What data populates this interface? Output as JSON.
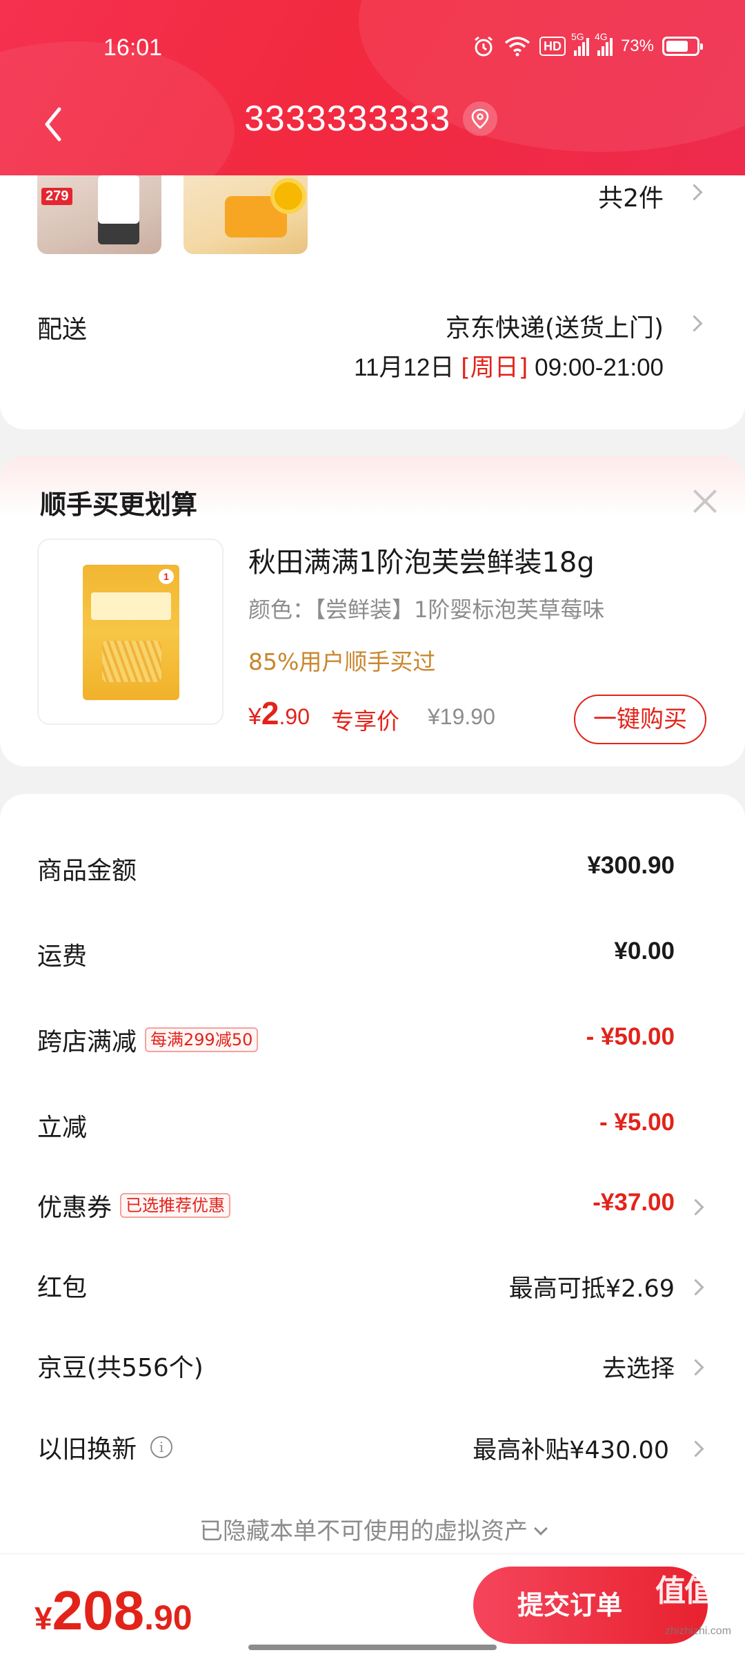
{
  "status_bar": {
    "time": "16:01",
    "hd": "HD",
    "net1": "5G",
    "net2": "4G",
    "battery_text": "73%",
    "battery_level": 0.73
  },
  "nav": {
    "title": "3333333333"
  },
  "items_summary": {
    "thumb1_price": "279",
    "count_text": "共2件"
  },
  "delivery": {
    "label": "配送",
    "method": "京东快递(送货上门)",
    "date": "11月12日",
    "weekday": "[周日]",
    "time_range": "09:00-21:00"
  },
  "upsell": {
    "title": "顺手买更划算",
    "product_name": "秋田满满1阶泡芙尝鲜装18g",
    "spec": "颜色：【尝鲜装】1阶婴标泡芙草莓味",
    "hint": "85%用户顺手买过",
    "price_currency": "¥",
    "price_int": "2",
    "price_dec": ".90",
    "exclusive_label": "专享价",
    "original_price": "¥19.90",
    "buy_label": "一键购买"
  },
  "summary": {
    "rows": [
      {
        "label": "商品金额",
        "value": "¥300.90"
      },
      {
        "label": "运费",
        "value": "¥0.00"
      },
      {
        "label": "跨店满减",
        "tag": "每满299减50",
        "value": "- ¥50.00"
      },
      {
        "label": "立减",
        "value": "- ¥5.00"
      },
      {
        "label": "优惠券",
        "tag": "已选推荐优惠",
        "value": "-¥37.00"
      },
      {
        "label": "红包",
        "value": "最高可抵¥2.69"
      },
      {
        "label": "京豆(共556个)",
        "value": "去选择"
      },
      {
        "label": "以旧换新",
        "value": "最高补贴¥430.00"
      }
    ],
    "hidden_note": "已隐藏本单不可使用的虚拟资产"
  },
  "footer": {
    "total_currency": "¥",
    "total_int": "208",
    "total_dec": ".90",
    "submit_label": "提交订单"
  },
  "watermark": {
    "text": "值值值",
    "sub": "zhizhizhi.com"
  },
  "colors": {
    "brand_red": "#e2231a",
    "header_red": "#f2293f",
    "hint_orange": "#c9862c",
    "muted_gray": "#8c8c8c"
  },
  "icons": [
    "back-arrow-icon",
    "location-pin-icon",
    "alarm-icon",
    "wifi-icon",
    "signal-icon",
    "battery-icon",
    "chevron-right-icon",
    "close-icon",
    "info-icon",
    "chevron-down-icon"
  ]
}
